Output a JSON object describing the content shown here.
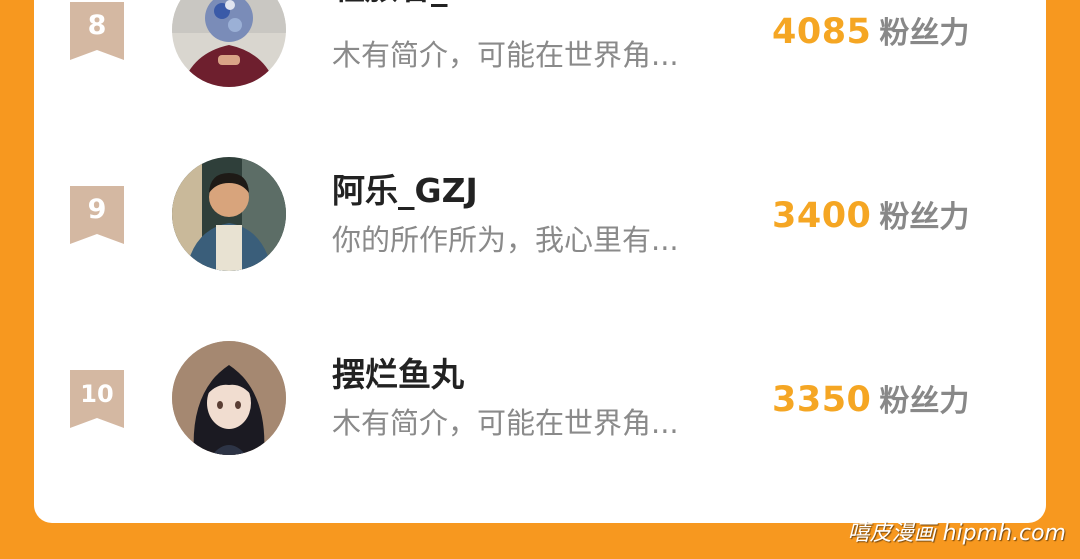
{
  "leaderboard": {
    "entries": [
      {
        "rank": "8",
        "name": "轻旅者_",
        "bio": "木有简介，可能在世界角...",
        "score": "4085",
        "unit": "粉丝力",
        "avatar": "avatar-hooded-figure-icon"
      },
      {
        "rank": "9",
        "name": "阿乐_GZJ",
        "bio": "你的所作所为，我心里有...",
        "score": "3400",
        "unit": "粉丝力",
        "avatar": "avatar-man-photo-icon"
      },
      {
        "rank": "10",
        "name": "摆烂鱼丸",
        "bio": "木有简介，可能在世界角...",
        "score": "3350",
        "unit": "粉丝力",
        "avatar": "avatar-anime-girl-icon"
      }
    ]
  },
  "watermark": "嘻皮漫画 hipmh.com",
  "colors": {
    "background": "#f7981f",
    "card": "#ffffff",
    "score": "#f5a623",
    "badge": "#d4b8a2"
  }
}
